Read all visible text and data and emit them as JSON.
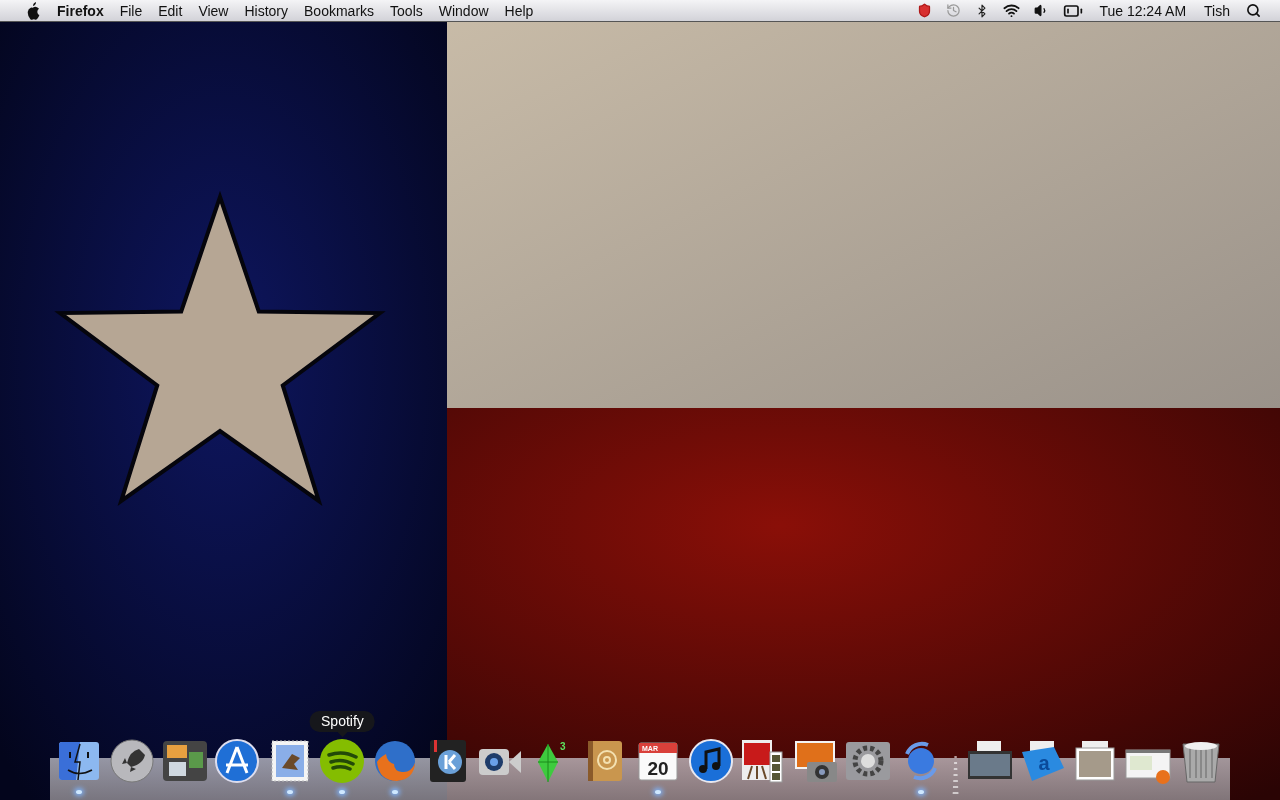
{
  "menu_bar": {
    "app_name": "Firefox",
    "menus": [
      "File",
      "Edit",
      "View",
      "History",
      "Bookmarks",
      "Tools",
      "Window",
      "Help"
    ],
    "clock": "Tue 12:24 AM",
    "user": "Tish"
  },
  "dock": {
    "items": [
      {
        "kind": "app",
        "running": true
      },
      {
        "kind": "app",
        "running": false
      },
      {
        "kind": "app",
        "running": false
      },
      {
        "kind": "app",
        "running": false
      },
      {
        "kind": "app",
        "running": true
      },
      {
        "kind": "app",
        "running": true,
        "tooltip": "Spotify"
      },
      {
        "kind": "app",
        "running": true
      },
      {
        "kind": "app",
        "running": false
      },
      {
        "kind": "app",
        "running": false
      },
      {
        "kind": "app",
        "running": false,
        "icon_text": [
          "3"
        ]
      },
      {
        "kind": "app",
        "running": false
      },
      {
        "kind": "app",
        "running": true,
        "icon_text": [
          "MAR",
          "20"
        ]
      },
      {
        "kind": "app",
        "running": false
      },
      {
        "kind": "app",
        "running": false
      },
      {
        "kind": "app",
        "running": false
      },
      {
        "kind": "app",
        "running": false
      },
      {
        "kind": "app",
        "running": true
      },
      {
        "kind": "window",
        "running": false
      },
      {
        "kind": "window",
        "running": false,
        "icon_text": [
          "a"
        ]
      },
      {
        "kind": "window",
        "running": false
      },
      {
        "kind": "window",
        "running": false
      },
      {
        "kind": "trash",
        "running": false
      }
    ]
  }
}
